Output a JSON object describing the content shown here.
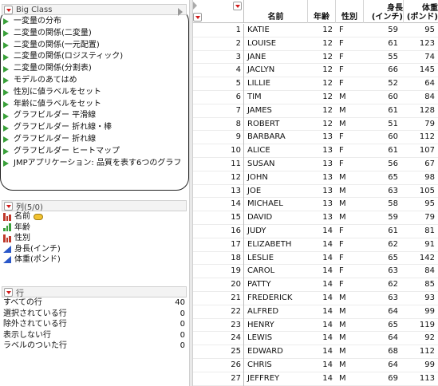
{
  "table_panel": {
    "title": "Big Class",
    "scripts": [
      "一変量の分布",
      "二変量の関係(二変量)",
      "二変量の関係(一元配置)",
      "二変量の関係(ロジスティック)",
      "二変量の関係(分割表)",
      "モデルのあてはめ",
      "性別に値ラベルをセット",
      "年齢に値ラベルをセット",
      "グラフビルダー 平滑線",
      "グラフビルダー 折れ線・棒",
      "グラフビルダー 折れ線",
      "グラフビルダー ヒートマップ",
      "JMPアプリケーション: 品質を表す6つのグラフ"
    ]
  },
  "columns_panel": {
    "title": "列(5/0)",
    "columns": [
      {
        "name": "名前",
        "type": "nominal",
        "tagged": true
      },
      {
        "name": "年齢",
        "type": "ordinal",
        "tagged": false
      },
      {
        "name": "性別",
        "type": "nominal",
        "tagged": false
      },
      {
        "name": "身長(インチ)",
        "type": "continuous",
        "tagged": false
      },
      {
        "name": "体重(ポンド)",
        "type": "continuous",
        "tagged": false
      }
    ]
  },
  "rows_panel": {
    "title": "行",
    "items": [
      {
        "label": "すべての行",
        "count": "40"
      },
      {
        "label": "選択されている行",
        "count": "0"
      },
      {
        "label": "除外されている行",
        "count": "0"
      },
      {
        "label": "表示しない行",
        "count": "0"
      },
      {
        "label": "ラベルのついた行",
        "count": "0"
      }
    ]
  },
  "grid": {
    "headers": {
      "name": "名前",
      "age": "年齢",
      "sex": "性別",
      "height_l1": "身長",
      "height_l2": "(インチ)",
      "weight_l1": "体重",
      "weight_l2": "(ポンド)"
    },
    "rows": [
      {
        "n": "1",
        "name": "KATIE",
        "age": "12",
        "sex": "F",
        "h": "59",
        "w": "95"
      },
      {
        "n": "2",
        "name": "LOUISE",
        "age": "12",
        "sex": "F",
        "h": "61",
        "w": "123"
      },
      {
        "n": "3",
        "name": "JANE",
        "age": "12",
        "sex": "F",
        "h": "55",
        "w": "74"
      },
      {
        "n": "4",
        "name": "JACLYN",
        "age": "12",
        "sex": "F",
        "h": "66",
        "w": "145"
      },
      {
        "n": "5",
        "name": "LILLIE",
        "age": "12",
        "sex": "F",
        "h": "52",
        "w": "64"
      },
      {
        "n": "6",
        "name": "TIM",
        "age": "12",
        "sex": "M",
        "h": "60",
        "w": "84"
      },
      {
        "n": "7",
        "name": "JAMES",
        "age": "12",
        "sex": "M",
        "h": "61",
        "w": "128"
      },
      {
        "n": "8",
        "name": "ROBERT",
        "age": "12",
        "sex": "M",
        "h": "51",
        "w": "79"
      },
      {
        "n": "9",
        "name": "BARBARA",
        "age": "13",
        "sex": "F",
        "h": "60",
        "w": "112"
      },
      {
        "n": "10",
        "name": "ALICE",
        "age": "13",
        "sex": "F",
        "h": "61",
        "w": "107"
      },
      {
        "n": "11",
        "name": "SUSAN",
        "age": "13",
        "sex": "F",
        "h": "56",
        "w": "67"
      },
      {
        "n": "12",
        "name": "JOHN",
        "age": "13",
        "sex": "M",
        "h": "65",
        "w": "98"
      },
      {
        "n": "13",
        "name": "JOE",
        "age": "13",
        "sex": "M",
        "h": "63",
        "w": "105"
      },
      {
        "n": "14",
        "name": "MICHAEL",
        "age": "13",
        "sex": "M",
        "h": "58",
        "w": "95"
      },
      {
        "n": "15",
        "name": "DAVID",
        "age": "13",
        "sex": "M",
        "h": "59",
        "w": "79"
      },
      {
        "n": "16",
        "name": "JUDY",
        "age": "14",
        "sex": "F",
        "h": "61",
        "w": "81"
      },
      {
        "n": "17",
        "name": "ELIZABETH",
        "age": "14",
        "sex": "F",
        "h": "62",
        "w": "91"
      },
      {
        "n": "18",
        "name": "LESLIE",
        "age": "14",
        "sex": "F",
        "h": "65",
        "w": "142"
      },
      {
        "n": "19",
        "name": "CAROL",
        "age": "14",
        "sex": "F",
        "h": "63",
        "w": "84"
      },
      {
        "n": "20",
        "name": "PATTY",
        "age": "14",
        "sex": "F",
        "h": "62",
        "w": "85"
      },
      {
        "n": "21",
        "name": "FREDERICK",
        "age": "14",
        "sex": "M",
        "h": "63",
        "w": "93"
      },
      {
        "n": "22",
        "name": "ALFRED",
        "age": "14",
        "sex": "M",
        "h": "64",
        "w": "99"
      },
      {
        "n": "23",
        "name": "HENRY",
        "age": "14",
        "sex": "M",
        "h": "65",
        "w": "119"
      },
      {
        "n": "24",
        "name": "LEWIS",
        "age": "14",
        "sex": "M",
        "h": "64",
        "w": "92"
      },
      {
        "n": "25",
        "name": "EDWARD",
        "age": "14",
        "sex": "M",
        "h": "68",
        "w": "112"
      },
      {
        "n": "26",
        "name": "CHRIS",
        "age": "14",
        "sex": "M",
        "h": "64",
        "w": "99"
      },
      {
        "n": "27",
        "name": "JEFFREY",
        "age": "14",
        "sex": "M",
        "h": "69",
        "w": "113"
      }
    ]
  },
  "colors": {
    "script_play": "#3aa03a",
    "menu_triangle": "#d11a1a",
    "nominal": "#c0392b",
    "ordinal": "#3aa03a",
    "continuous": "#2a57c9"
  }
}
